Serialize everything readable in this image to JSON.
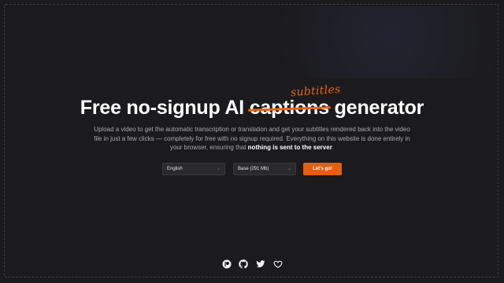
{
  "hero": {
    "title_before": "Free no-signup AI ",
    "title_struck": "captions",
    "title_replacement": "subtitles",
    "title_after": " generator",
    "description_main": "Upload a video to get the automatic transcription or translation and get your subtitles rendered back into the video file in just a few clicks — completely for free with no signup required. Everything on this website is done entirely in your browser, ensuring that ",
    "description_bold": "nothing is sent to the server",
    "description_end": "."
  },
  "controls": {
    "language_value": "English",
    "model_value": "Base (291 Mb)",
    "go_label": "Let's go!"
  },
  "social": {
    "icons": [
      "patreon-icon",
      "github-icon",
      "twitter-icon",
      "heart-icon"
    ]
  },
  "colors": {
    "background": "#1b1b1d",
    "accent": "#e35f12",
    "text": "#ffffff",
    "muted": "#a8a8ad"
  }
}
